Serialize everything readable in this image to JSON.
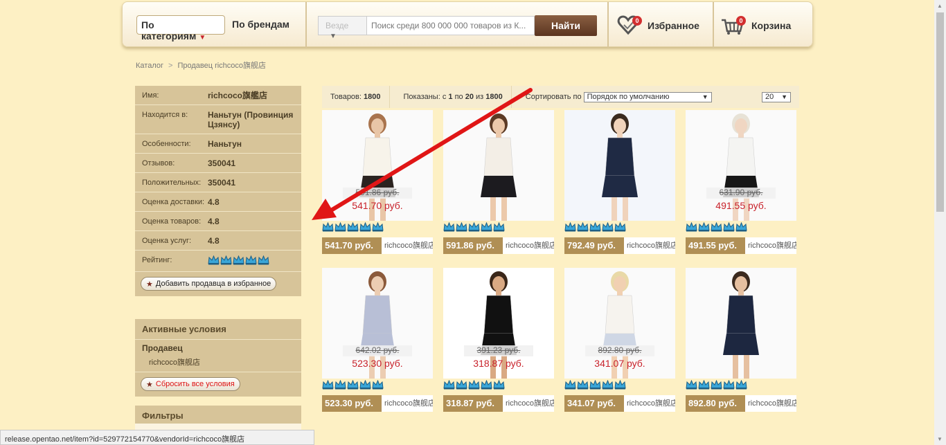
{
  "header": {
    "category_select": "По категориям",
    "brands_link": "По брендам",
    "where_select": "Везде",
    "search_placeholder": "Поиск среди 800 000 000 товаров из К...",
    "search_button": "Найти",
    "favorites_label": "Избранное",
    "favorites_count": "0",
    "cart_label": "Корзина",
    "cart_count": "0"
  },
  "breadcrumb": [
    "Каталог",
    "Продавец richcoco旗舰店"
  ],
  "seller": {
    "rows": [
      {
        "key": "Имя:",
        "value": "richcoco旗艦店"
      },
      {
        "key": "Находится в:",
        "value": "Наньтун (Провинция Цзянсу)"
      },
      {
        "key": "Особенности:",
        "value": "Наньтун"
      },
      {
        "key": "Отзывов:",
        "value": "350041"
      },
      {
        "key": "Положительных:",
        "value": "350041"
      },
      {
        "key": "Оценка доставки:",
        "value": "4.8"
      },
      {
        "key": "Оценка товаров:",
        "value": "4.8"
      },
      {
        "key": "Оценка услуг:",
        "value": "4.8"
      },
      {
        "key": "Рейтинг:",
        "value": ""
      }
    ],
    "add_favorite_button": "Добавить продавца в избранное"
  },
  "active_conditions": {
    "title": "Активные условия",
    "seller_label": "Продавец",
    "seller_value": "richcoco旗舰店",
    "reset_button": "Сбросить все условия"
  },
  "filters": {
    "title": "Фильтры"
  },
  "toolbar": {
    "items_label": "Товаров:",
    "items_count": "1800",
    "shown_prefix": "Показаны: с",
    "shown_from": "1",
    "shown_to_word": "по",
    "shown_to": "20",
    "shown_of_word": "из",
    "shown_total": "1800",
    "sort_label": "Сортировать по",
    "sort_value": "Порядок по умолчанию",
    "per_page": "20"
  },
  "products": [
    {
      "price": "541.70 руб.",
      "seller": "richcoco旗舰店",
      "old_price": "591.86 руб.",
      "new_price": "541.70 руб."
    },
    {
      "price": "591.86 руб.",
      "seller": "richcoco旗舰店",
      "old_price": "",
      "new_price": ""
    },
    {
      "price": "792.49 руб.",
      "seller": "richcoco旗舰店",
      "old_price": "",
      "new_price": ""
    },
    {
      "price": "491.55 руб.",
      "seller": "richcoco旗舰店",
      "old_price": "631.90 руб.",
      "new_price": "491.55 руб."
    },
    {
      "price": "523.30 руб.",
      "seller": "richcoco旗舰店",
      "old_price": "642.02 руб.",
      "new_price": "523.30 руб."
    },
    {
      "price": "318.87 руб.",
      "seller": "richcoco旗舰店",
      "old_price": "391.23 руб.",
      "new_price": "318.87 руб."
    },
    {
      "price": "341.07 руб.",
      "seller": "richcoco旗舰店",
      "old_price": "892.80 руб.",
      "new_price": "341.07 руб."
    },
    {
      "price": "892.80 руб.",
      "seller": "richcoco旗舰店",
      "old_price": "",
      "new_price": ""
    }
  ],
  "status_bar": "release.opentao.net/item?id=529772154770&vendorId=richcoco旗舰店",
  "icons": {
    "favorites": "heart-icon",
    "cart": "basket-icon",
    "rating": "crown-icon",
    "star": "star-icon"
  },
  "colors": {
    "page_bg": "#fdf0c4",
    "panel_bg": "#d7c499",
    "price_bar": "#b08f55",
    "accent_red": "#c8222b",
    "search_button": "#6b4127",
    "arrow": "#e01616"
  }
}
